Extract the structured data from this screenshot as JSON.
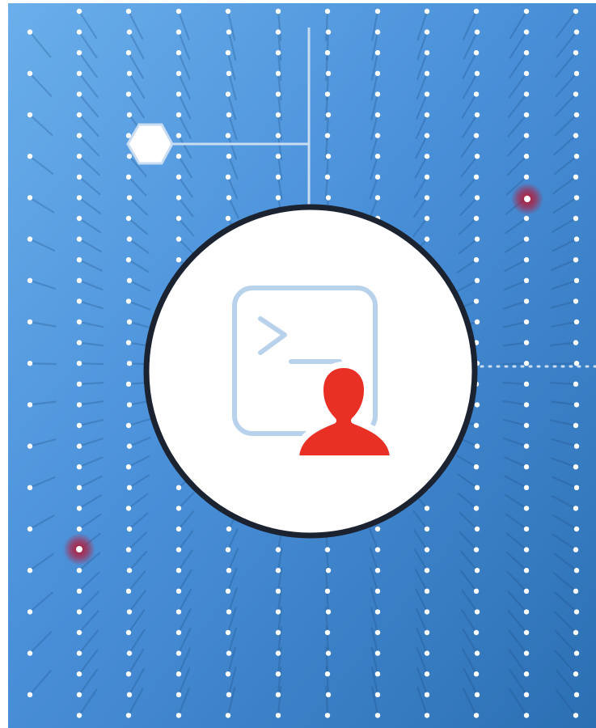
{
  "illustration": {
    "subject": "user-terminal-access",
    "icons": [
      "terminal-prompt-icon",
      "user-silhouette-icon",
      "hexagon-icon"
    ],
    "colors": {
      "background_top_left": "#6aaeea",
      "background_mid": "#4a90d9",
      "background_bottom_right": "#2c6fb3",
      "grid_dot": "#ffffff",
      "connector_line": "#c8dcf2",
      "circle_fill": "#ffffff",
      "circle_border": "#1b2230",
      "terminal_outline": "#b8d2ec",
      "user_icon": "#e93025",
      "alert_glow": "#c0102a"
    }
  }
}
